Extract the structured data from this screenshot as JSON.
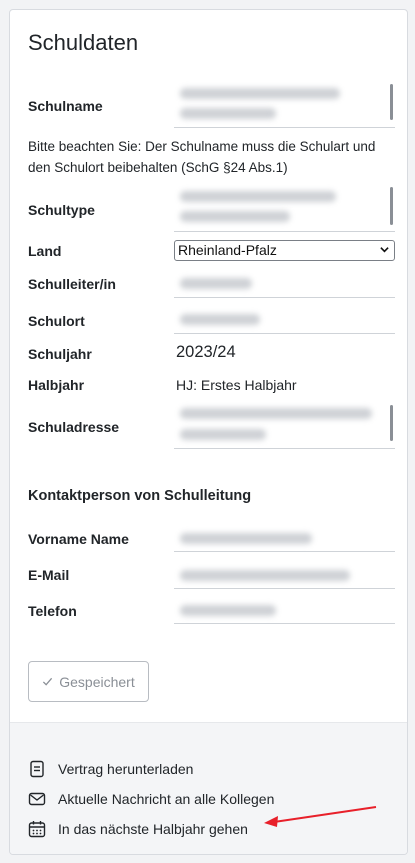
{
  "card": {
    "title": "Schuldaten"
  },
  "form": {
    "schulname_label": "Schulname",
    "hint": "Bitte beachten Sie: Der Schulname muss die Schulart und den Schulort beibehalten (SchG §24 Abs.1)",
    "schultype_label": "Schultype",
    "land_label": "Land",
    "land_value": "Rheinland-Pfalz",
    "schulleiter_label": "Schulleiter/in",
    "schulort_label": "Schulort",
    "schuljahr_label": "Schuljahr",
    "schuljahr_value": "2023/24",
    "halbjahr_label": "Halbjahr",
    "halbjahr_value": "HJ: Erstes Halbjahr",
    "schuladresse_label": "Schuladresse"
  },
  "contact": {
    "section_title": "Kontaktperson von Schulleitung",
    "name_label": "Vorname Name",
    "email_label": "E-Mail",
    "telefon_label": "Telefon"
  },
  "save_button": {
    "label": "Gespeichert",
    "icon": "check-icon"
  },
  "actions": [
    {
      "label": "Vertrag herunterladen",
      "icon": "document-icon"
    },
    {
      "label": "Aktuelle Nachricht an alle Kollegen",
      "icon": "envelope-icon"
    },
    {
      "label": "In das nächste Halbjahr gehen",
      "icon": "calendar-icon"
    }
  ],
  "colors": {
    "annotation_arrow": "#e8202a",
    "border": "#cfd3d8",
    "footer_bg": "#f4f5f7"
  }
}
